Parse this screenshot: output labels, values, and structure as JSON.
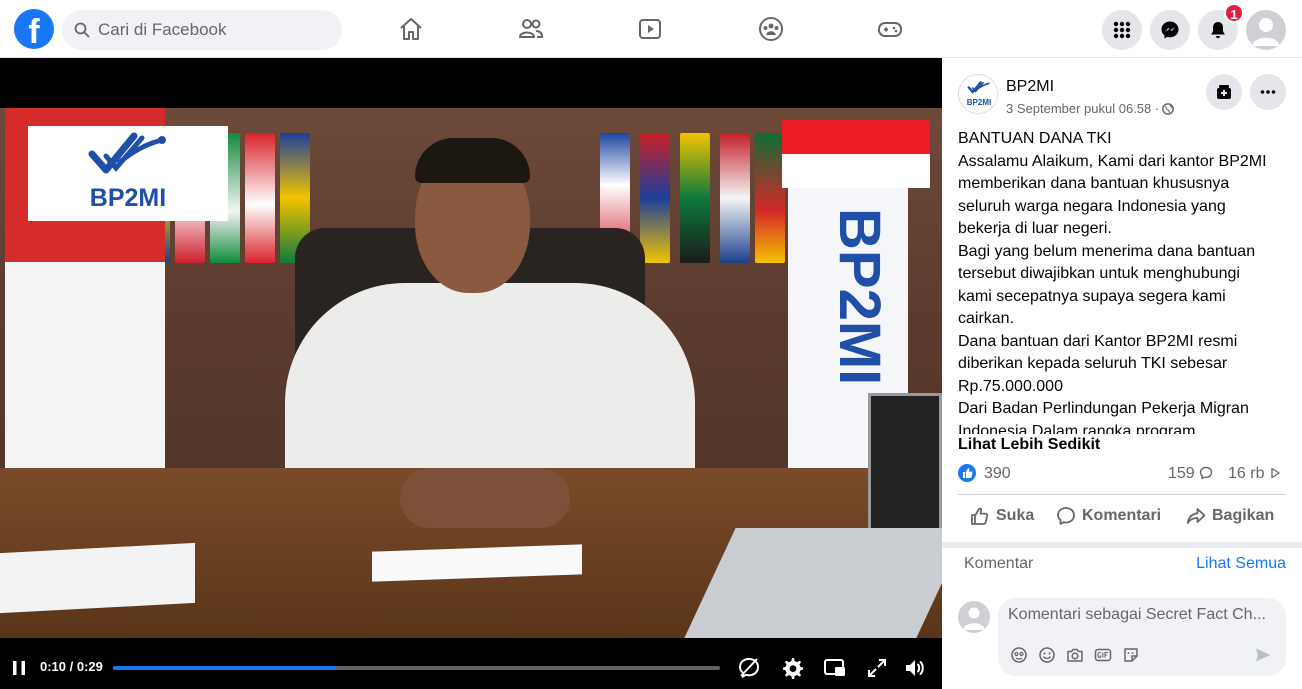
{
  "topbar": {
    "logo_letter": "f",
    "search_placeholder": "Cari di Facebook",
    "notification_count": "1"
  },
  "video": {
    "logo_text": "BP2MI",
    "banner_text": "BP2MI",
    "time": "0:10 / 0:29",
    "progress": 0.367
  },
  "post": {
    "page_name": "BP2MI",
    "date": "3 September pukul 06.58 ·",
    "avatar_text": "BP2MI",
    "text": [
      "BANTUAN DANA TKI",
      "Assalamu Alaikum, Kami dari kantor BP2MI memberikan dana bantuan khususnya seluruh warga negara Indonesia yang bekerja di luar negeri.",
      "Bagi yang belum menerima dana bantuan tersebut diwajibkan untuk menghubungi kami secepatnya supaya segera kami cairkan.",
      "Dana bantuan dari Kantor BP2MI resmi diberikan kepada seluruh TKI sebesar Rp.75.000.000",
      "Dari Badan Perlindungan Pekerja Migran Indonesia Dalam rangka program"
    ],
    "see_less": "Lihat Lebih Sedikit",
    "reaction_count": "390",
    "comment_count": "159",
    "share_count": "16 rb",
    "actions": {
      "like": "Suka",
      "comment": "Komentari",
      "share": "Bagikan"
    },
    "comments_label": "Komentar",
    "see_all": "Lihat Semua",
    "comment_placeholder": "Komentari sebagai Secret Fact Ch..."
  }
}
